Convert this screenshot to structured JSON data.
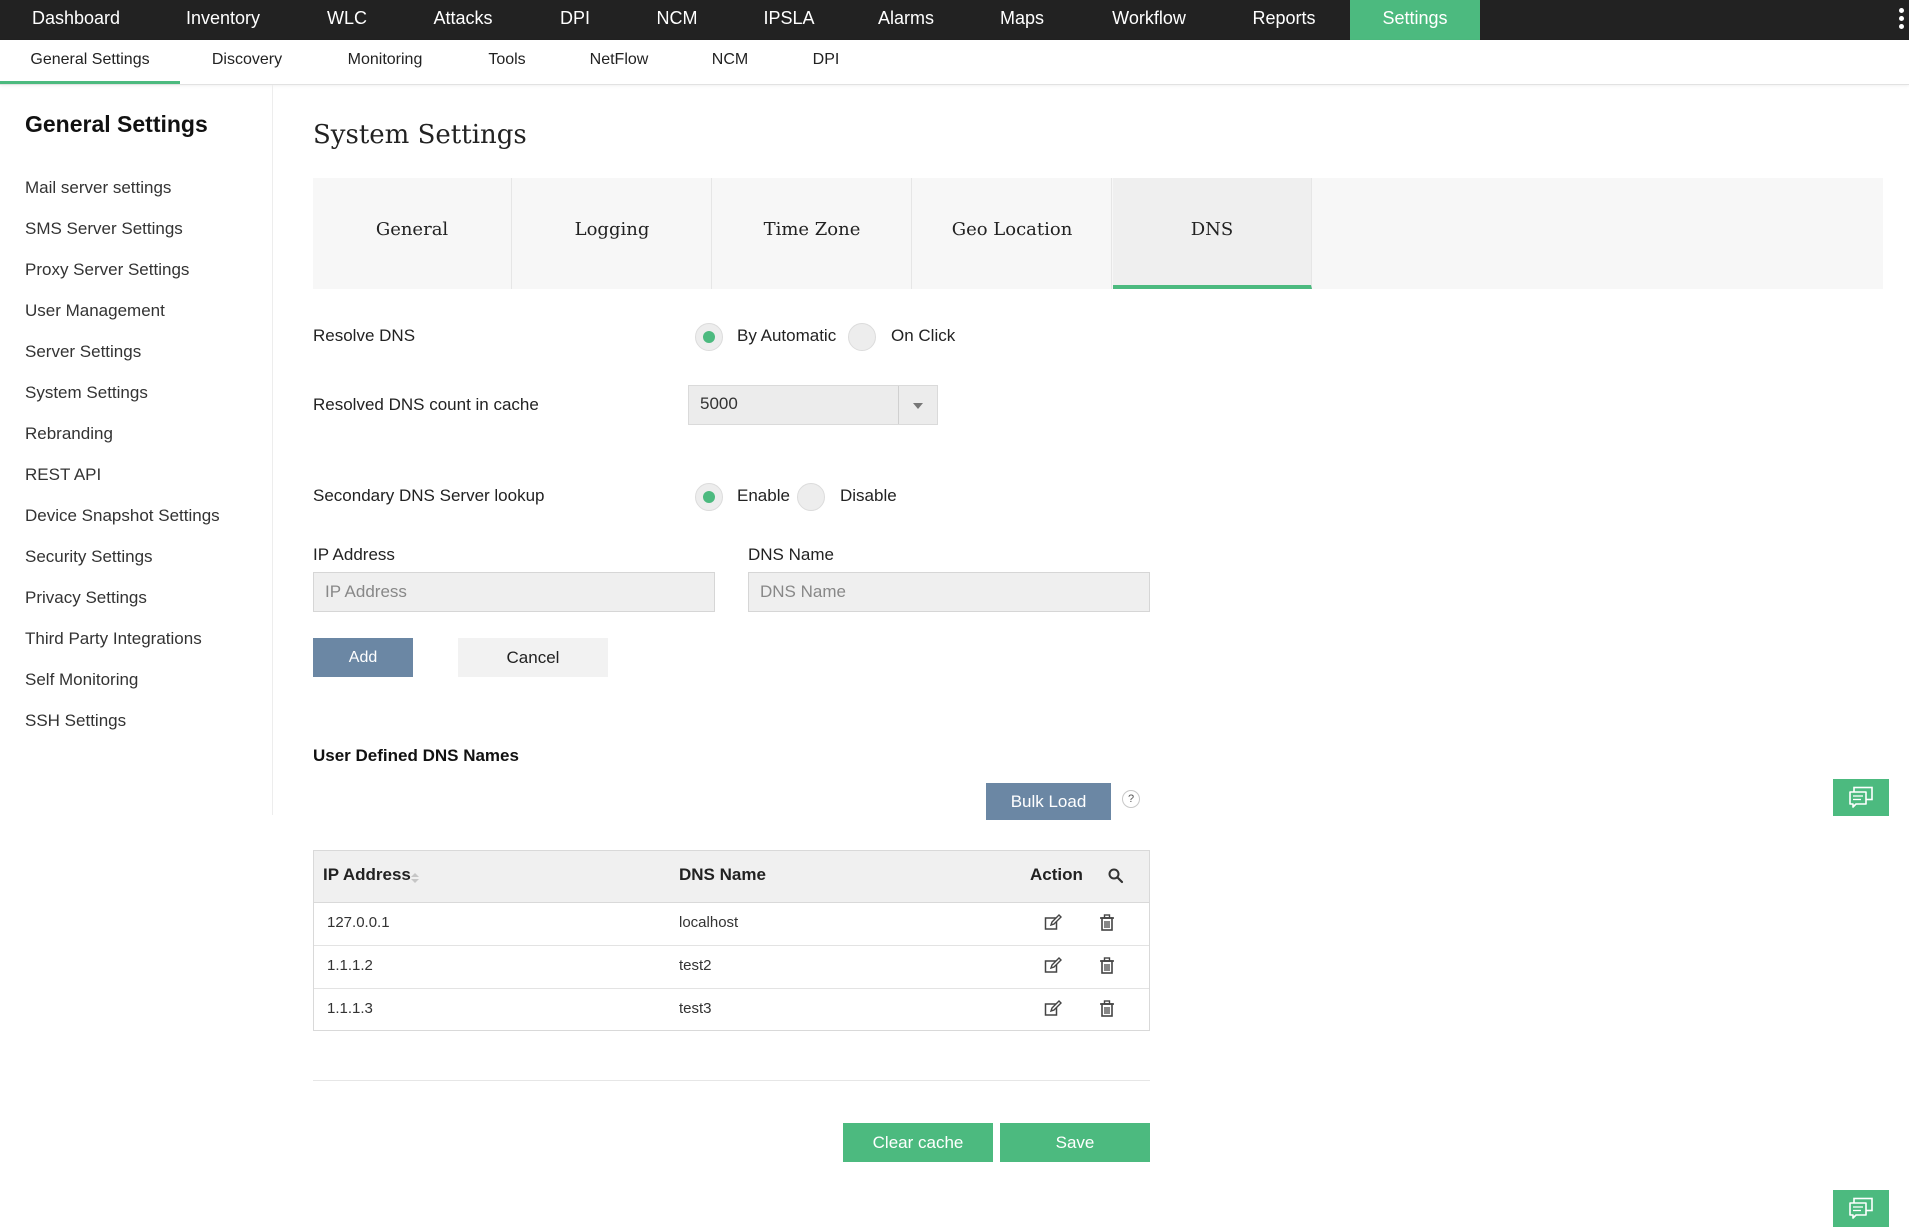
{
  "top_nav": {
    "items": [
      "Dashboard",
      "Inventory",
      "WLC",
      "Attacks",
      "DPI",
      "NCM",
      "IPSLA",
      "Alarms",
      "Maps",
      "Workflow",
      "Reports",
      "Settings"
    ],
    "active": "Settings",
    "more_icon": "kebab-menu-icon"
  },
  "sub_nav": {
    "items": [
      "General Settings",
      "Discovery",
      "Monitoring",
      "Tools",
      "NetFlow",
      "NCM",
      "DPI"
    ],
    "active": "General Settings"
  },
  "sidebar": {
    "title": "General Settings",
    "items": [
      "Mail server settings",
      "SMS Server Settings",
      "Proxy Server Settings",
      "User Management",
      "Server Settings",
      "System Settings",
      "Rebranding",
      "REST API",
      "Device Snapshot Settings",
      "Security Settings",
      "Privacy Settings",
      "Third Party Integrations",
      "Self Monitoring",
      "SSH Settings"
    ]
  },
  "main": {
    "title": "System Settings",
    "tabs": [
      "General",
      "Logging",
      "Time Zone",
      "Geo Location",
      "DNS"
    ],
    "active_tab": "DNS",
    "resolve_dns": {
      "label": "Resolve DNS",
      "options": [
        "By Automatic",
        "On Click"
      ],
      "selected": "By Automatic"
    },
    "cache_count": {
      "label": "Resolved DNS count in cache",
      "value": "5000"
    },
    "secondary_lookup": {
      "label": "Secondary DNS Server lookup",
      "options": [
        "Enable",
        "Disable"
      ],
      "selected": "Enable"
    },
    "ip_field": {
      "label": "IP Address",
      "placeholder": "IP Address",
      "value": ""
    },
    "dns_field": {
      "label": "DNS Name",
      "placeholder": "DNS Name",
      "value": ""
    },
    "add_label": "Add",
    "cancel_label": "Cancel",
    "user_defined": {
      "title": "User Defined DNS Names",
      "bulk_load_label": "Bulk Load",
      "help_text": "?",
      "columns": [
        "IP Address",
        "DNS Name",
        "Action"
      ],
      "rows": [
        {
          "ip": "127.0.0.1",
          "dns": "localhost"
        },
        {
          "ip": "1.1.1.2",
          "dns": "test2"
        },
        {
          "ip": "1.1.1.3",
          "dns": "test3"
        }
      ]
    },
    "clear_cache_label": "Clear cache",
    "save_label": "Save"
  },
  "colors": {
    "accent": "#4cba7f",
    "nav_bg": "#222222",
    "button_blue": "#6b87a4"
  }
}
